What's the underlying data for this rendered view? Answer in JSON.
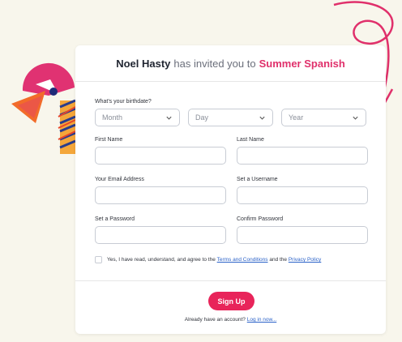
{
  "header": {
    "inviter": "Noel Hasty",
    "middle_text": "has invited you to",
    "course": "Summer Spanish"
  },
  "birthdate": {
    "label": "What's your birthdate?",
    "month": "Month",
    "day": "Day",
    "year": "Year"
  },
  "fields": {
    "first_name": "First Name",
    "last_name": "Last Name",
    "email": "Your Email Address",
    "username": "Set a Username",
    "password": "Set a Password",
    "confirm_password": "Confirm Password"
  },
  "agree": {
    "prefix": "Yes, I have read, understand, and agree to the",
    "terms": "Terms and Conditions",
    "and": "and the",
    "privacy": "Privacy Policy"
  },
  "signup_label": "Sign Up",
  "login": {
    "prompt": "Already have an account?",
    "link": "Log in now..."
  },
  "colors": {
    "accent": "#e8245a",
    "link": "#2b62c8",
    "background": "#f8f6ec"
  }
}
